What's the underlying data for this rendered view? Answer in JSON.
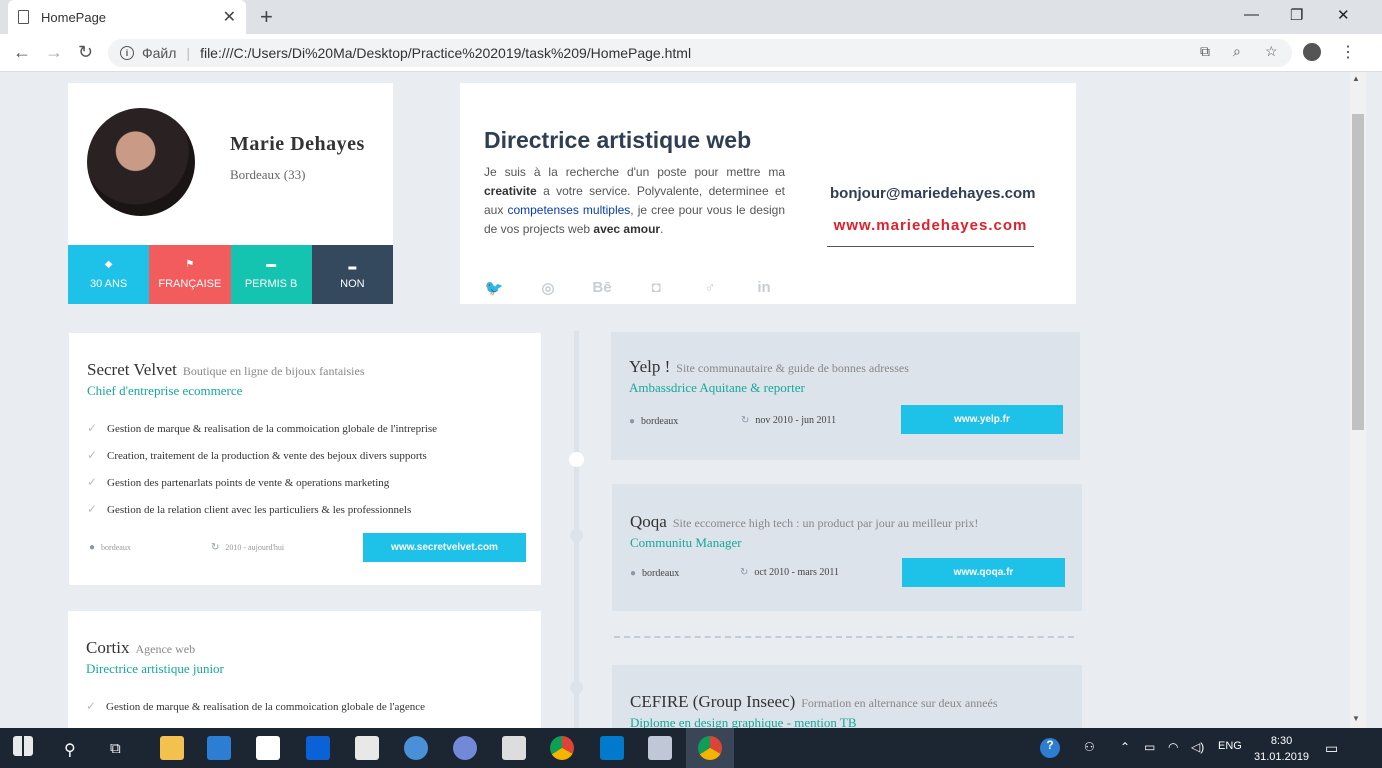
{
  "browser": {
    "tab_title": "HomePage",
    "address_scheme": "Файл",
    "address_url": "file:///C:/Users/Di%20Ma/Desktop/Practice%202019/task%209/HomePage.html"
  },
  "profile": {
    "name": "Marie Dehayes",
    "location": "Bordeaux (33)",
    "stats": [
      {
        "icon": "eye-icon",
        "label": "30 ANS"
      },
      {
        "icon": "flag-icon",
        "label": "FRANÇAISE"
      },
      {
        "icon": "car-icon",
        "label": "PERMIS B"
      },
      {
        "icon": "smoking-icon",
        "label": "NON"
      }
    ]
  },
  "intro": {
    "job_title": "Directrice artistique web",
    "desc_1": "Je suis à la recherche d'un poste pour mettre ma ",
    "desc_b1": "creativite",
    "desc_2": " a votre service. Polyvalente, determinee et aux ",
    "desc_hl": "competenses multiples",
    "desc_3": ", je cree pour vous le design de vos projects web ",
    "desc_b2": "avec amour",
    "desc_4": ".",
    "email": "bonjour@mariedehayes.com",
    "website": "www.mariedehayes.com",
    "socials": [
      "twitter-icon",
      "dribbble-icon",
      "behance-icon",
      "instagram-icon",
      "venus-icon",
      "linkedin-icon"
    ],
    "social_glyphs": [
      "🐦",
      "◎",
      "Bē",
      "◘",
      "♂",
      "in"
    ]
  },
  "experiences_left": [
    {
      "company": "Secret Velvet",
      "tag": "Boutique en ligne de bijoux fantaisies",
      "role": "Chief d'entreprise ecommerce",
      "bullets": [
        "Gestion de marque & realisation de la commoication globale de l'intreprise",
        "Creation, traitement de la production & vente des bejoux divers supports",
        "Gestion des partenarlats points de vente & operations marketing",
        "Gestion de la relation client avec les particuliers & les professionnels"
      ],
      "place": "bordeaux",
      "dates": "2010 - aujourd'hui",
      "link": "www.secretvelvet.com"
    },
    {
      "company": "Cortix",
      "tag": "Agence web",
      "role": "Directrice artistique junior",
      "bullets": [
        "Gestion de marque & realisation de la commoication globale de l'agence"
      ]
    }
  ],
  "experiences_right": [
    {
      "company": "Yelp !",
      "tag": "Site communautaire & guide de bonnes adresses",
      "role": "Ambassdrice Aquitane & reporter",
      "place": "bordeaux",
      "dates": "nov 2010 - jun 2011",
      "link": "www.yelp.fr"
    },
    {
      "company": "Qoqa",
      "tag": "Site eccomerce high tech : un product par jour au meilleur prix!",
      "role": "Communitu Manager",
      "place": "bordeaux",
      "dates": "oct 2010 - mars 2011",
      "link": "www.qoqa.fr"
    },
    {
      "company": "CEFIRE (Group Inseec)",
      "tag": "Formation en alternance sur deux anneés",
      "role": "Diplome en design graphique - mention TB"
    }
  ],
  "taskbar": {
    "lang": "ENG",
    "time": "8:30",
    "date": "31.01.2019"
  },
  "colors": {
    "cyan": "#1ec1e7",
    "red": "#f25c5c",
    "teal": "#14c3b0",
    "navy": "#34495e",
    "accent_green": "#16a89a",
    "web_red": "#e0202a"
  }
}
